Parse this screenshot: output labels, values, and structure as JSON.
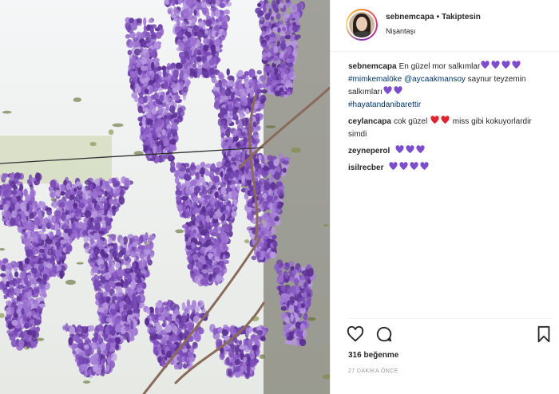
{
  "post": {
    "photo_subject": "wisteria-flowers",
    "header": {
      "username": "sebnemcapa",
      "separator": "•",
      "follow_state": "Takiptesin",
      "location": "Nişantaşı"
    },
    "caption": {
      "username": "sebnemcapa",
      "text_1": "En güzel mor salkımlar",
      "tag_1": "#mimkemalöke",
      "mention_1": "@aycaakmansoy",
      "text_2": "saynur teyzemin salkımları",
      "tag_2": "#hayatandanibarettir"
    },
    "comments": [
      {
        "username": "ceylancapa",
        "text_1": "cok güzel",
        "text_2": "miss gibi kokuyorlardir simdi",
        "hearts": [
          "red",
          "red"
        ]
      },
      {
        "username": "zeyneperol",
        "hearts": [
          "purple",
          "purple",
          "purple"
        ]
      },
      {
        "username": "isilrecber",
        "hearts": [
          "purple",
          "purple",
          "purple",
          "purple"
        ]
      }
    ],
    "likes_text": "316 beğenme",
    "time_text": "27 DAKİKA ÖNCE",
    "icons": [
      "heart-outline-icon",
      "comment-icon",
      "bookmark-icon"
    ],
    "colors": {
      "purple_heart": "#7c4dcc",
      "red_heart": "#e0242f",
      "link": "#003569",
      "divider": "#efefef"
    }
  }
}
